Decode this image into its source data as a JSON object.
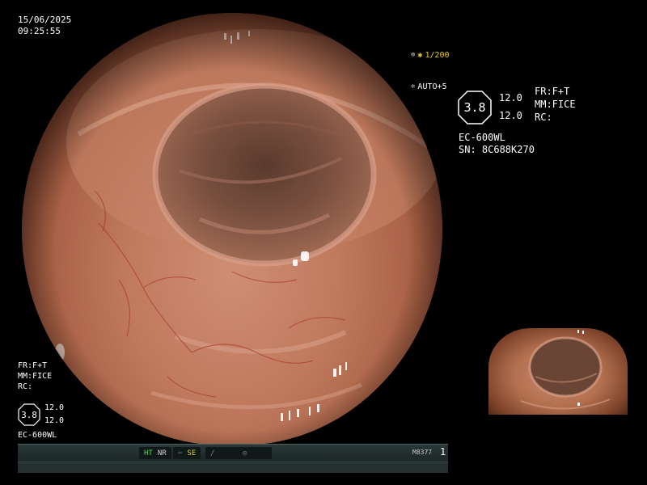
{
  "overlay": {
    "date": "15/06/2025",
    "time": "09:25:55",
    "shutter": "1/200",
    "exposure_mode": "AUTO+5"
  },
  "right_info": {
    "hex_value": "3.8",
    "value_a": "12.0",
    "value_b": "12.0",
    "fr": "FR:F+T",
    "mm": "MM:FICE",
    "rc": "RC:",
    "model": "EC-600WL",
    "serial": "SN: 8C688K270"
  },
  "left_info": {
    "fr": "FR:F+T",
    "mm": "MM:FICE",
    "rc": "RC:",
    "hex_value": "3.8",
    "value_a": "12.0",
    "value_b": "12.0",
    "model": "EC-600WL"
  },
  "status_bar": {
    "ht": "HT",
    "nr": "NR",
    "se": "SE",
    "code": "M8377",
    "page": "1"
  },
  "colors": {
    "mucosa": "#c07a5e",
    "vessel": "#a63a2a",
    "status_green": "#5fd35f",
    "status_yellow": "#d8d24a",
    "shutter_yellow": "#e6c62e"
  },
  "icons": [
    "shutter-icon",
    "iris-icon",
    "scissor-icon",
    "pen-icon",
    "aperture-icon"
  ]
}
